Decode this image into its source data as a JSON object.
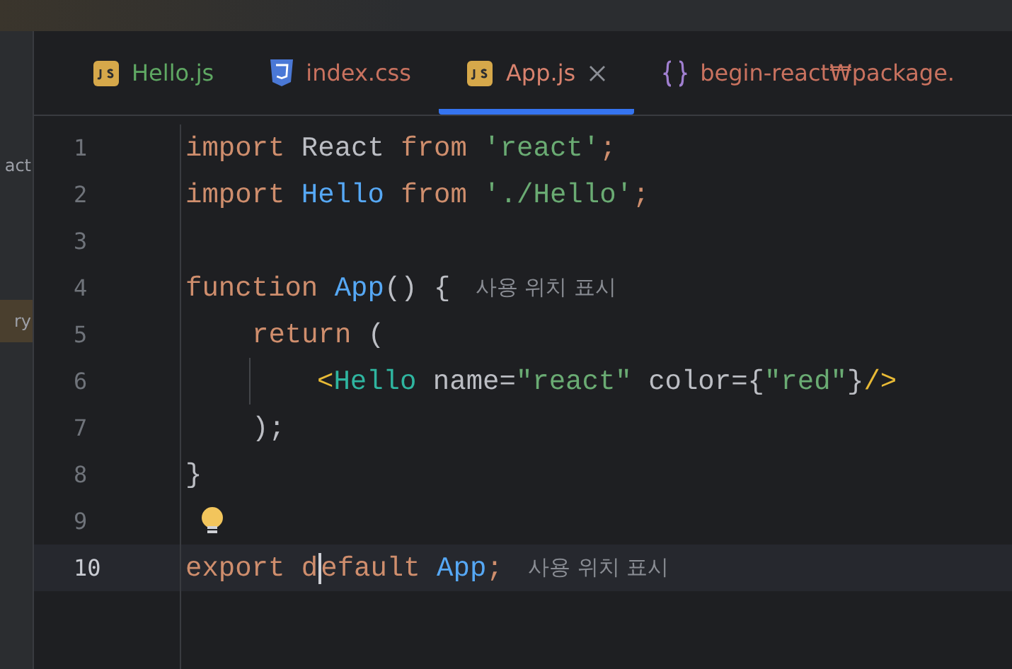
{
  "side_panel": {
    "items": [
      {
        "label": "act",
        "selected": false
      },
      {
        "label": "ry",
        "selected": true
      }
    ]
  },
  "tabs": [
    {
      "label": "Hello.js",
      "kind": "js",
      "color": "#5fa863",
      "selected": false,
      "closable": false
    },
    {
      "label": "index.css",
      "kind": "css",
      "color": "#c9725f",
      "selected": false,
      "closable": false
    },
    {
      "label": "App.js",
      "kind": "js",
      "color": "#d9826e",
      "selected": true,
      "closable": true
    },
    {
      "label": "begin-react₩package.",
      "kind": "json",
      "color": "#c9725f",
      "selected": false,
      "closable": false
    }
  ],
  "editor": {
    "lines": [
      {
        "number": "1",
        "current": false,
        "kind": "flat",
        "tokens": [
          {
            "kind": "keyword",
            "text": "import "
          },
          {
            "kind": "plain",
            "text": "React "
          },
          {
            "kind": "keyword",
            "text": "from "
          },
          {
            "kind": "string",
            "text": "'react'"
          },
          {
            "kind": "keyword",
            "text": ";"
          }
        ]
      },
      {
        "number": "2",
        "current": false,
        "kind": "flat",
        "tokens": [
          {
            "kind": "keyword",
            "text": "import "
          },
          {
            "kind": "ident",
            "text": "Hello "
          },
          {
            "kind": "keyword",
            "text": "from "
          },
          {
            "kind": "string",
            "text": "'./Hello'"
          },
          {
            "kind": "keyword",
            "text": ";"
          }
        ]
      },
      {
        "number": "3",
        "current": false,
        "kind": "flat"
      },
      {
        "number": "4",
        "current": false,
        "kind": "flat",
        "tokens": [
          {
            "kind": "keyword",
            "text": "function "
          },
          {
            "kind": "ident",
            "text": "App"
          },
          {
            "kind": "plain",
            "text": "() { "
          },
          {
            "kind": "hint",
            "text": "사용 위치 표시"
          }
        ]
      },
      {
        "number": "5",
        "current": false,
        "kind": "indented",
        "tokens": [
          {
            "kind": "keyword",
            "text": "return "
          },
          {
            "kind": "plain",
            "text": "("
          }
        ]
      },
      {
        "number": "6",
        "current": false,
        "kind": "guided",
        "tokens": [
          {
            "kind": "bracket",
            "text": "<"
          },
          {
            "kind": "tag",
            "text": "Hello "
          },
          {
            "kind": "plain",
            "text": "name="
          },
          {
            "kind": "string",
            "text": "\"react\" "
          },
          {
            "kind": "plain",
            "text": "color={"
          },
          {
            "kind": "string",
            "text": "\"red\""
          },
          {
            "kind": "plain",
            "text": "}"
          },
          {
            "kind": "bracket",
            "text": "/>"
          }
        ]
      },
      {
        "number": "7",
        "current": false,
        "kind": "indented",
        "tokens": [
          {
            "kind": "plain",
            "text": ");"
          }
        ]
      },
      {
        "number": "8",
        "current": false,
        "kind": "flat",
        "tokens": [
          {
            "kind": "plain",
            "text": "}"
          }
        ]
      },
      {
        "number": "9",
        "current": false,
        "kind": "flat",
        "bulb": true
      },
      {
        "number": "10",
        "current": true,
        "kind": "flat",
        "tokens": [
          {
            "kind": "keyword",
            "text": "export "
          },
          {
            "kind": "keyword",
            "text": "d",
            "caret": true
          },
          {
            "kind": "keyword",
            "text": "efault "
          },
          {
            "kind": "ident",
            "text": "App"
          },
          {
            "kind": "keyword",
            "text": "; "
          },
          {
            "kind": "hint",
            "text": "사용 위치 표시"
          }
        ]
      }
    ]
  }
}
